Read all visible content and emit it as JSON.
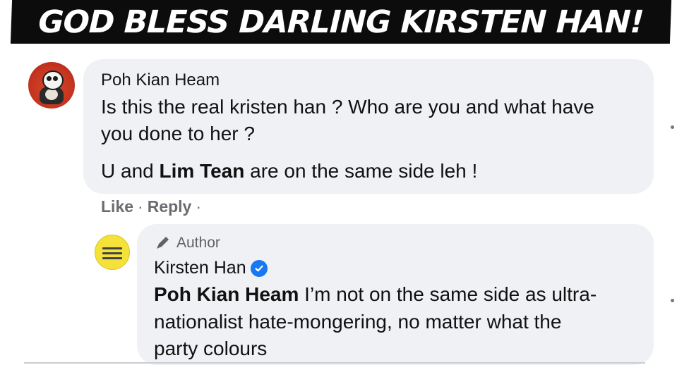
{
  "banner": {
    "title": "GOD BLESS DARLING KIRSTEN HAN!"
  },
  "comment": {
    "author": "Poh Kian Heam",
    "line1": "Is this the real kristen han ? Who are you and what have",
    "line2": "you done to her ?",
    "line3_pre": "U and ",
    "line3_bold": "Lim Tean",
    "line3_post": " are on the same side leh !",
    "actions": {
      "like": "Like",
      "sep1": "·",
      "reply": "Reply",
      "sep2": "·"
    }
  },
  "reply": {
    "badge": "Author",
    "author": "Kirsten Han",
    "mention": "Poh Kian Heam",
    "line1_rest": " I’m not on the same side as ultra-",
    "line2": "nationalist hate-mongering, no matter what the",
    "line3": "party colours"
  },
  "colors": {
    "verified": "#1877f2",
    "bubble": "#eff1f4",
    "banner": "#0c0c0c"
  }
}
